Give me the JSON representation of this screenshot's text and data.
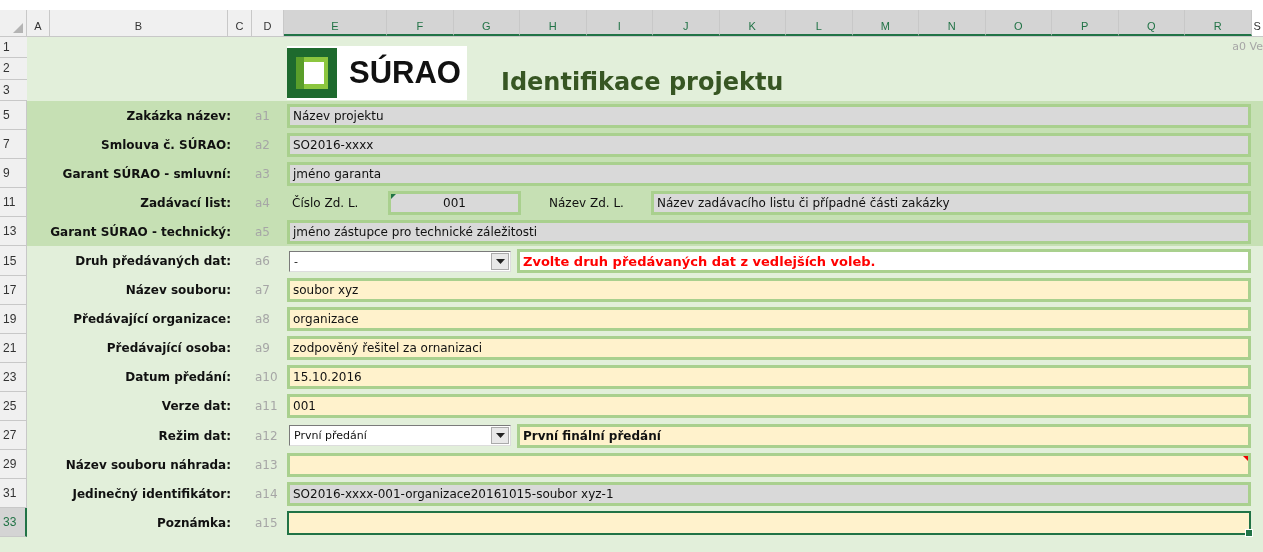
{
  "column_headers": [
    {
      "label": "A",
      "selected": false
    },
    {
      "label": "B",
      "selected": false
    },
    {
      "label": "C",
      "selected": false
    },
    {
      "label": "D",
      "selected": false
    },
    {
      "label": "E",
      "selected": true
    },
    {
      "label": "F",
      "selected": true
    },
    {
      "label": "G",
      "selected": true
    },
    {
      "label": "H",
      "selected": true
    },
    {
      "label": "I",
      "selected": true
    },
    {
      "label": "J",
      "selected": true
    },
    {
      "label": "K",
      "selected": true
    },
    {
      "label": "L",
      "selected": true
    },
    {
      "label": "M",
      "selected": true
    },
    {
      "label": "N",
      "selected": true
    },
    {
      "label": "O",
      "selected": true
    },
    {
      "label": "P",
      "selected": true
    },
    {
      "label": "Q",
      "selected": true
    },
    {
      "label": "R",
      "selected": true
    },
    {
      "label": "S",
      "selected": false
    }
  ],
  "header": {
    "rows": [
      "1",
      "2",
      "3"
    ],
    "logo_text": "SÚRAO",
    "title": "Identifikace projektu",
    "corner_note": "a0 Ve"
  },
  "sections": [
    {
      "kind": "dark",
      "rows": [
        {
          "row": "5",
          "label": "Zakázka název:",
          "code": "a1",
          "kind": "field",
          "locked": true,
          "value": "Název projektu",
          "comment": false,
          "selected": false
        },
        {
          "row": "7",
          "label": "Smlouva č. SÚRAO:",
          "code": "a2",
          "kind": "field",
          "locked": true,
          "value": "SO2016-xxxx",
          "comment": false,
          "selected": false
        },
        {
          "row": "9",
          "label": "Garant SÚRAO - smluvní:",
          "code": "a3",
          "kind": "field",
          "locked": true,
          "value": "jméno garanta",
          "comment": false,
          "selected": false
        },
        {
          "row": "11",
          "label": "Zadávací list:",
          "code": "a4",
          "kind": "split",
          "number_label": "Číslo Zd. L.",
          "number": "001",
          "flagged": true,
          "name_label": "Název Zd. L.",
          "name": "Název zadávacího listu či případné části zakázky",
          "selected": false
        },
        {
          "row": "13",
          "label": "Garant SÚRAO - technický:",
          "code": "a5",
          "kind": "field",
          "locked": true,
          "value": "jméno zástupce pro technické záležitosti",
          "comment": false,
          "selected": false
        }
      ]
    },
    {
      "kind": "light",
      "rows": [
        {
          "row": "15",
          "label": "Druh předávaných dat:",
          "code": "a6",
          "kind": "dropdown",
          "value": "-",
          "note": "Zvolte druh předávaných dat z vedlejších voleb.",
          "warning": true,
          "selected": false
        },
        {
          "row": "17",
          "label": "Název souboru:",
          "code": "a7",
          "kind": "field",
          "locked": false,
          "value": "soubor xyz",
          "comment": false,
          "selected": false
        },
        {
          "row": "19",
          "label": "Předávající organizace:",
          "code": "a8",
          "kind": "field",
          "locked": false,
          "value": "organizace",
          "comment": false,
          "selected": false
        },
        {
          "row": "21",
          "label": "Předávající osoba:",
          "code": "a9",
          "kind": "field",
          "locked": false,
          "value": "zodpověný řešitel za ornanizaci",
          "comment": false,
          "selected": false
        },
        {
          "row": "23",
          "label": "Datum předání:",
          "code": "a10",
          "kind": "field",
          "locked": false,
          "value": "15.10.2016",
          "comment": false,
          "selected": false
        },
        {
          "row": "25",
          "label": "Verze dat:",
          "code": "a11",
          "kind": "field",
          "locked": false,
          "value": "001",
          "comment": false,
          "selected": false
        },
        {
          "row": "27",
          "label": "Režim dat:",
          "code": "a12",
          "kind": "dropdown",
          "value": "První předání",
          "note": "První finální předání",
          "warning": false,
          "selected": false
        },
        {
          "row": "29",
          "label": "Název souboru náhrada:",
          "code": "a13",
          "kind": "field",
          "locked": false,
          "comment": true,
          "selected": false
        },
        {
          "row": "31",
          "label": "Jedinečný identifikátor:",
          "code": "a14",
          "kind": "field",
          "locked": true,
          "value": "SO2016-xxxx-001-organizace20161015-soubor xyz-1",
          "comment": false,
          "selected": false
        },
        {
          "row": "33",
          "label": "Poznámka:",
          "code": "a15",
          "kind": "field",
          "locked": false,
          "comment": false,
          "selected": true
        }
      ]
    }
  ]
}
